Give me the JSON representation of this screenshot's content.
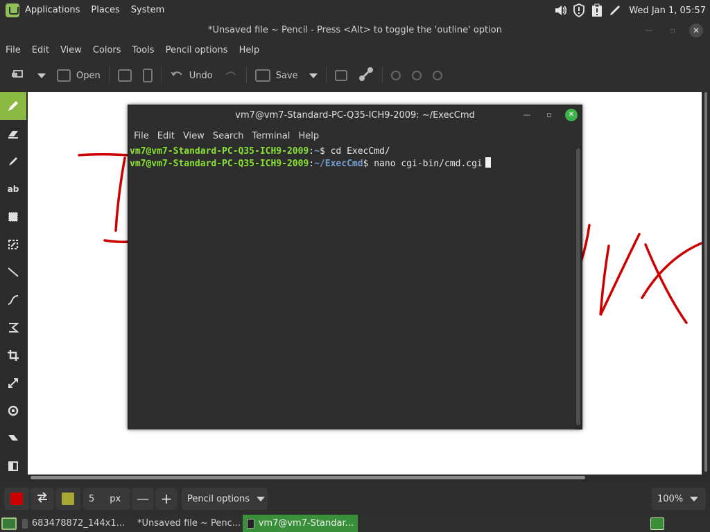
{
  "top_panel": {
    "menus": [
      "Applications",
      "Places",
      "System"
    ],
    "clock": "Wed Jan  1, 05:57",
    "tray_icons": [
      "volume-icon",
      "shield-icon",
      "clipboard-icon",
      "pen-icon"
    ]
  },
  "window": {
    "title": "*Unsaved file ~ Pencil - Press <Alt> to toggle the 'outline' option"
  },
  "menubar": [
    "File",
    "Edit",
    "View",
    "Colors",
    "Tools",
    "Pencil options",
    "Help"
  ],
  "toolbar": {
    "open_label": "Open",
    "undo_label": "Undo",
    "save_label": "Save"
  },
  "tools": [
    "pencil-icon",
    "eraser-icon",
    "highlighter-icon",
    "text-icon",
    "rectangle-select-icon",
    "free-select-icon",
    "line-icon",
    "curve-icon",
    "shape-icon",
    "crop-icon",
    "scale-icon",
    "rotate-icon",
    "skew-icon",
    "filters-icon"
  ],
  "terminal": {
    "title": "vm7@vm7-Standard-PC-Q35-ICH9-2009: ~/ExecCmd",
    "menu": [
      "File",
      "Edit",
      "View",
      "Search",
      "Terminal",
      "Help"
    ],
    "lines": [
      {
        "user": "vm7@vm7-Standard-PC-Q35-ICH9-2009",
        "sep": ":",
        "path": "~",
        "prompt": "$ ",
        "cmd": "cd ExecCmd/"
      },
      {
        "user": "vm7@vm7-Standard-PC-Q35-ICH9-2009",
        "sep": ":",
        "path": "~/ExecCmd",
        "prompt": "$ ",
        "cmd": "nano cgi-bin/cmd.cgi"
      }
    ]
  },
  "options_bar": {
    "primary_color": "#cc0000",
    "secondary_color": "#a8a832",
    "size_value": "5",
    "size_unit": "px",
    "tool_options_label": "Pencil options",
    "zoom": "100%"
  },
  "taskbar": {
    "tasks": [
      {
        "label": "683478872_144x1..."
      },
      {
        "label": "*Unsaved file ~ Penc..."
      },
      {
        "label": "vm7@vm7-Standar..."
      }
    ]
  }
}
